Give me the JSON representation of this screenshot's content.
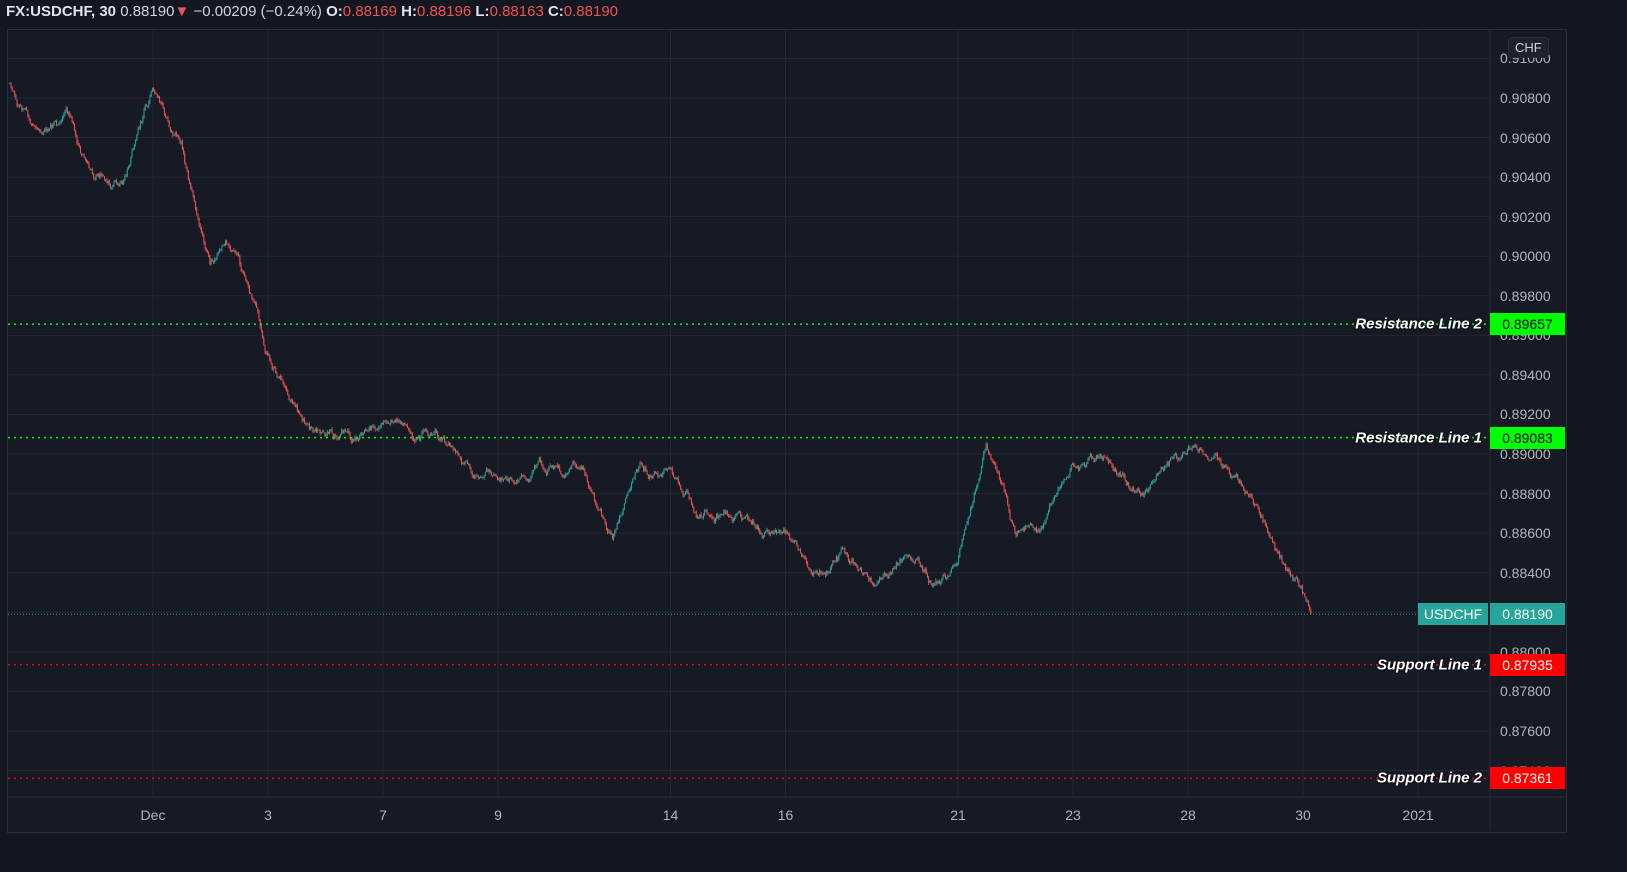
{
  "header": {
    "symbol": "FX:USDCHF, 30",
    "last": "0.88190",
    "change_icon": "triangle-down-icon",
    "change": "−0.00209 (−0.24%)",
    "o_label": "O:",
    "o": "0.88169",
    "h_label": "H:",
    "h": "0.88196",
    "l_label": "L:",
    "l": "0.88163",
    "c_label": "C:",
    "c": "0.88190"
  },
  "currency_badge": "CHF",
  "colors": {
    "up": "#26a69a",
    "down": "#ef5350",
    "resistance": "#00ff00",
    "support": "#ff0000",
    "background": "#161a25",
    "grid": "#232733"
  },
  "chart_data": {
    "type": "candlestick",
    "interval": "30",
    "ylim": [
      0.873,
      0.9105
    ],
    "y_ticks": [
      "0.91000",
      "0.90800",
      "0.90600",
      "0.90400",
      "0.90200",
      "0.90000",
      "0.89800",
      "0.89600",
      "0.89400",
      "0.89200",
      "0.89000",
      "0.88800",
      "0.88600",
      "0.88400",
      "0.88200",
      "0.88000",
      "0.87800",
      "0.87600",
      "0.87400"
    ],
    "x_ticks": [
      {
        "date": "2020-12-01",
        "label": "Dec"
      },
      {
        "date": "2020-12-03",
        "label": "3"
      },
      {
        "date": "2020-12-07",
        "label": "7"
      },
      {
        "date": "2020-12-09",
        "label": "9"
      },
      {
        "date": "2020-12-14",
        "label": "14"
      },
      {
        "date": "2020-12-16",
        "label": "16"
      },
      {
        "date": "2020-12-21",
        "label": "21"
      },
      {
        "date": "2020-12-23",
        "label": "23"
      },
      {
        "date": "2020-12-28",
        "label": "28"
      },
      {
        "date": "2020-12-30",
        "label": "30"
      },
      {
        "date": "2021-01-01",
        "label": "2021"
      }
    ],
    "price_path": [
      [
        "2020-11-26 12:00",
        0.9087
      ],
      [
        "2020-11-27 00:00",
        0.9064
      ],
      [
        "2020-11-27 12:00",
        0.9075
      ],
      [
        "2020-11-30 00:00",
        0.9039
      ],
      [
        "2020-11-30 12:00",
        0.9038
      ],
      [
        "2020-12-01 00:00",
        0.9085
      ],
      [
        "2020-12-01 12:00",
        0.9058
      ],
      [
        "2020-12-02 00:00",
        0.8996
      ],
      [
        "2020-12-02 12:00",
        0.9
      ],
      [
        "2020-12-03 00:00",
        0.895
      ],
      [
        "2020-12-03 12:00",
        0.8925
      ],
      [
        "2020-12-04 00:00",
        0.8909
      ],
      [
        "2020-12-04 12:00",
        0.8907
      ],
      [
        "2020-12-07 00:00",
        0.8915
      ],
      [
        "2020-12-07 12:00",
        0.891
      ],
      [
        "2020-12-08 00:00",
        0.8908
      ],
      [
        "2020-12-08 12:00",
        0.8895
      ],
      [
        "2020-12-09 00:00",
        0.8887
      ],
      [
        "2020-12-09 12:00",
        0.8887
      ],
      [
        "2020-12-10 00:00",
        0.8894
      ],
      [
        "2020-12-10 12:00",
        0.8892
      ],
      [
        "2020-12-11 00:00",
        0.8857
      ],
      [
        "2020-12-11 12:00",
        0.8895
      ],
      [
        "2020-12-14 00:00",
        0.8893
      ],
      [
        "2020-12-14 12:00",
        0.8868
      ],
      [
        "2020-12-15 00:00",
        0.8869
      ],
      [
        "2020-12-15 12:00",
        0.8862
      ],
      [
        "2020-12-16 00:00",
        0.886
      ],
      [
        "2020-12-16 12:00",
        0.884
      ],
      [
        "2020-12-17 00:00",
        0.8852
      ],
      [
        "2020-12-17 12:00",
        0.8835
      ],
      [
        "2020-12-18 00:00",
        0.8847
      ],
      [
        "2020-12-18 12:00",
        0.8835
      ],
      [
        "2020-12-21 00:00",
        0.8845
      ],
      [
        "2020-12-21 12:00",
        0.8905
      ],
      [
        "2020-12-22 00:00",
        0.886
      ],
      [
        "2020-12-22 12:00",
        0.8865
      ],
      [
        "2020-12-23 00:00",
        0.8895
      ],
      [
        "2020-12-23 12:00",
        0.8898
      ],
      [
        "2020-12-24 00:00",
        0.8882
      ],
      [
        "2020-12-24 12:00",
        0.889
      ],
      [
        "2020-12-28 00:00",
        0.8902
      ],
      [
        "2020-12-28 12:00",
        0.89
      ],
      [
        "2020-12-29 00:00",
        0.888
      ],
      [
        "2020-12-29 12:00",
        0.8855
      ],
      [
        "2020-12-30 00:00",
        0.883
      ],
      [
        "2020-12-30 03:30",
        0.8819
      ]
    ],
    "last_price": {
      "label": "USDCHF",
      "value": "0.88190",
      "price": 0.8819
    },
    "levels": [
      {
        "name": "Resistance Line 2",
        "value": "0.89657",
        "price": 0.89657,
        "kind": "resistance"
      },
      {
        "name": "Resistance Line 1",
        "value": "0.89083",
        "price": 0.89083,
        "kind": "resistance"
      },
      {
        "name": "Support Line 1",
        "value": "0.87935",
        "price": 0.87935,
        "kind": "support"
      },
      {
        "name": "Support Line 2",
        "value": "0.87361",
        "price": 0.87361,
        "kind": "support"
      }
    ]
  }
}
